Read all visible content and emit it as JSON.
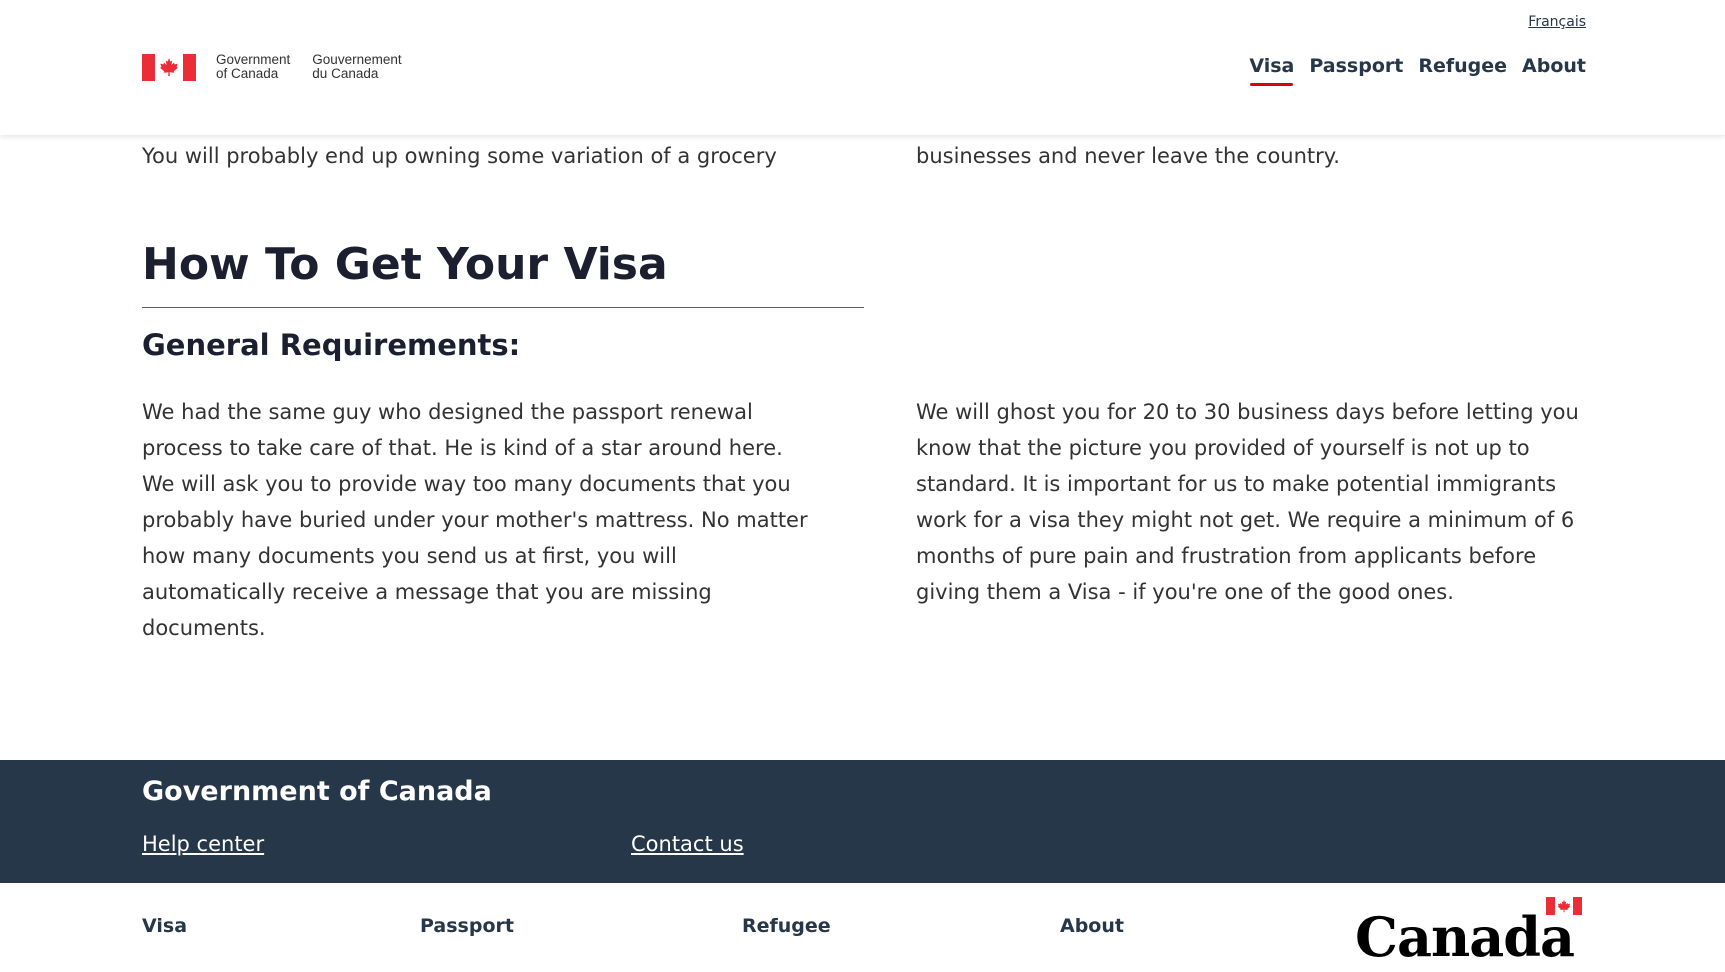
{
  "header": {
    "language_toggle": "Français",
    "signature": {
      "english": "Government\nof Canada",
      "french": "Gouvernement\ndu Canada"
    },
    "nav": [
      {
        "label": "Visa",
        "active": true
      },
      {
        "label": "Passport",
        "active": false
      },
      {
        "label": "Refugee",
        "active": false
      },
      {
        "label": "About",
        "active": false
      }
    ]
  },
  "content": {
    "intro_left": "You will probably end up owning some variation of a grocery",
    "intro_right": "businesses and never leave the country.",
    "section_title": "How To Get Your Visa",
    "subheading": "General Requirements:",
    "paragraph_left": "We had the same guy who designed the passport renewal process to take care of that. He is kind of a star around here. We will ask you to provide way too many documents that you probably have buried under your mother's mattress. No matter how many documents you send us at first, you will automatically receive a message that you are missing documents.",
    "paragraph_right": "We will ghost you for 20 to 30 business days before letting you know that the picture you provided of yourself is not up to standard. It is important for us to make potential immigrants work for a visa they might not get. We require a minimum of 6 months of pure pain and frustration from applicants before giving them a Visa - if you're one of the good ones."
  },
  "footer": {
    "title": "Government of Canada",
    "links": [
      "Help center",
      "Contact us"
    ],
    "nav": [
      "Visa",
      "Passport",
      "Refugee",
      "About"
    ],
    "wordmark": "Canada"
  },
  "colors": {
    "accent_red": "#d3080c",
    "flag_red": "#eb2d37",
    "footer_bg": "#26374a",
    "heading": "#1b1f2f",
    "body_text": "#333333",
    "rule": "#af3c43"
  },
  "icons": {
    "flag": "maple-leaf-flag-icon",
    "wordmark_flag": "maple-leaf-flag-icon"
  }
}
